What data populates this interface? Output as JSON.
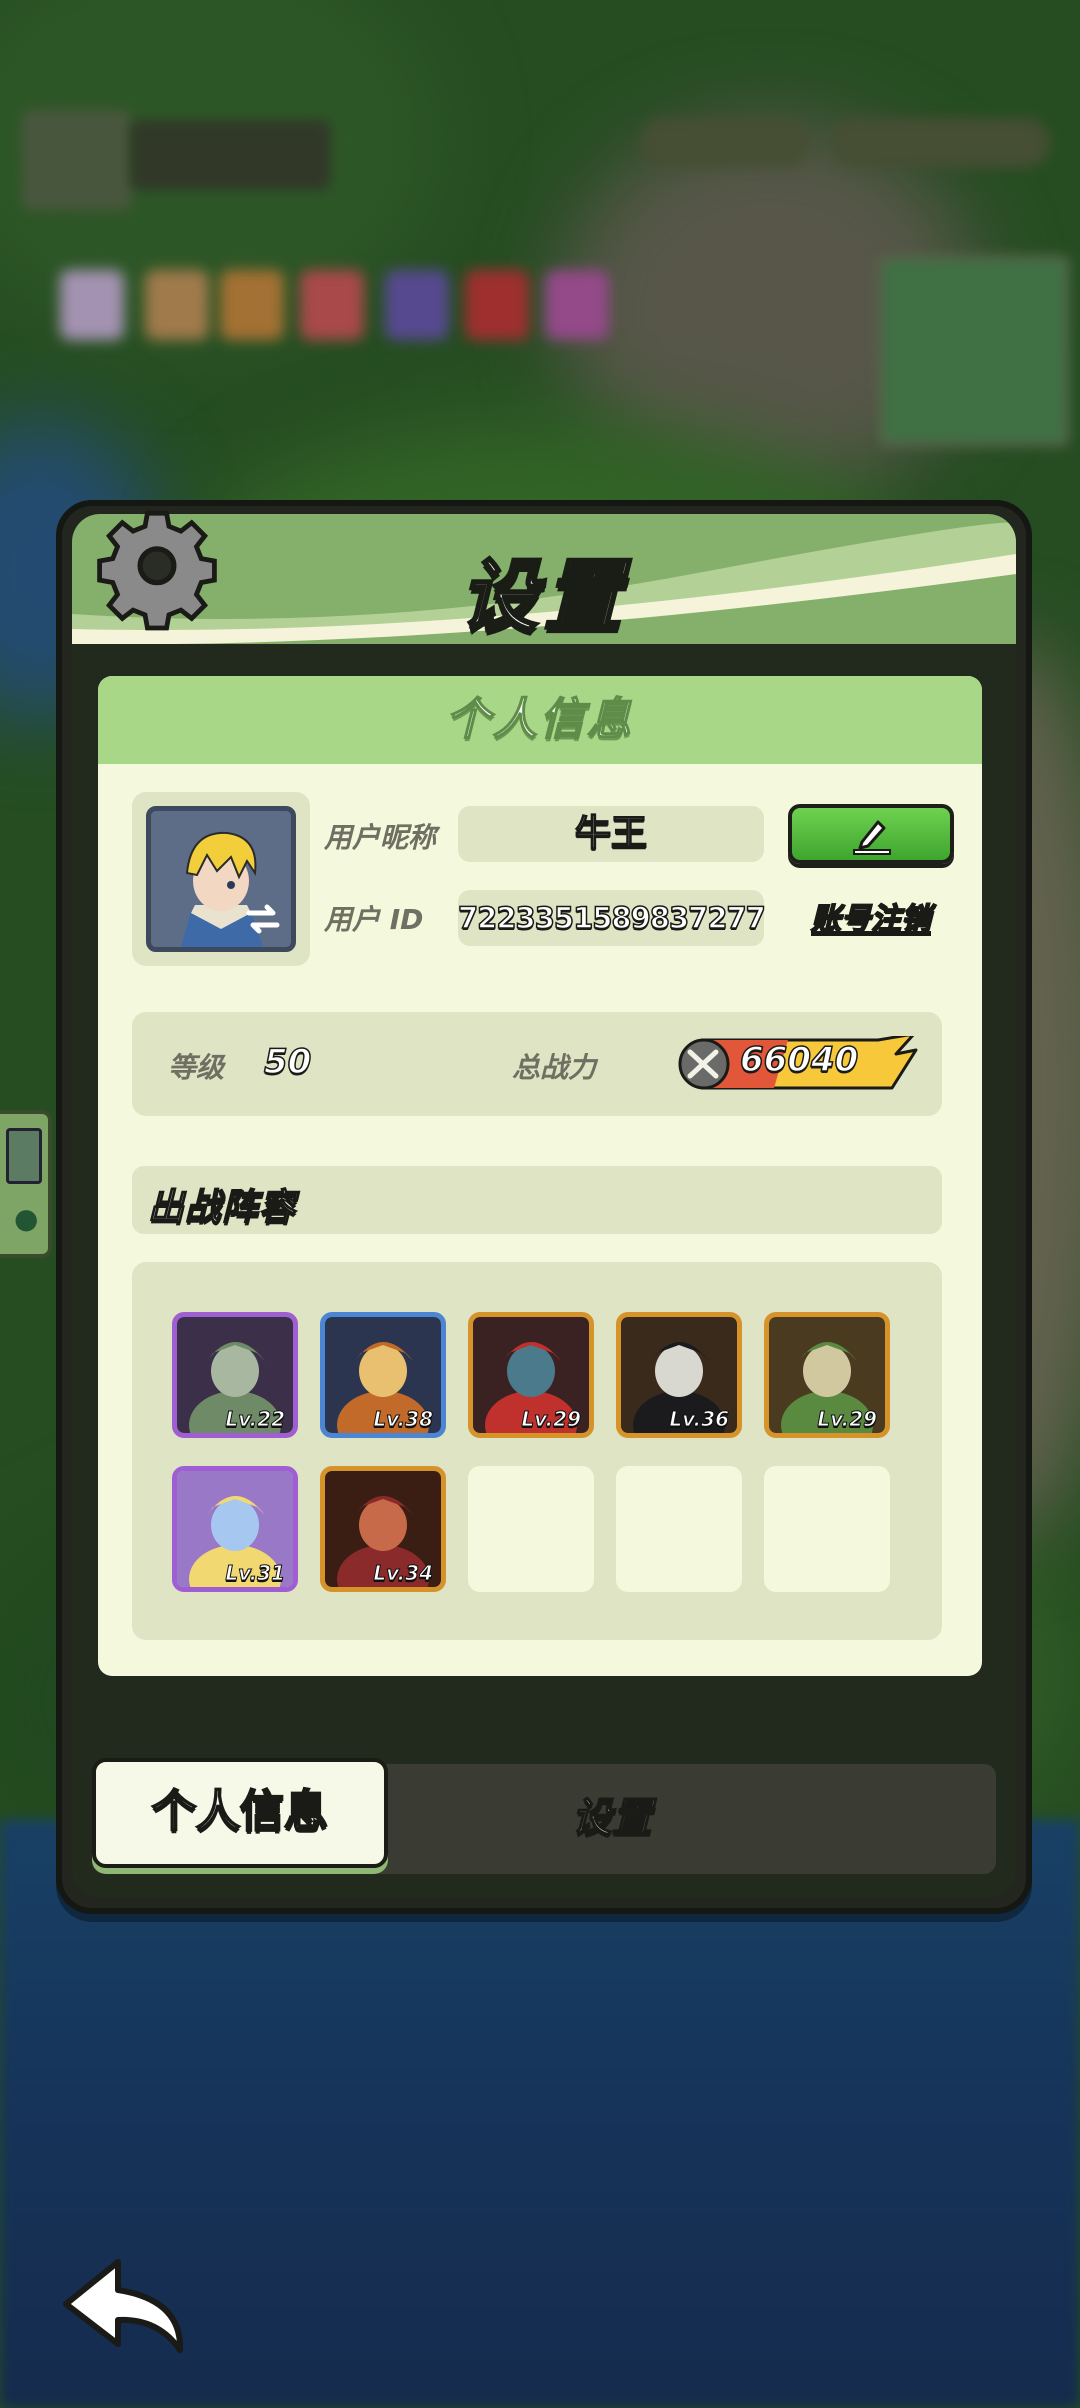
{
  "panel": {
    "title": "设置"
  },
  "info_card": {
    "header": "个人信息",
    "nickname_label": "用户昵称",
    "nickname_value": "牛王",
    "userid_label": "用户 ID",
    "userid_value": "7223351589837277",
    "cancel_account_label": "账号注销",
    "level_label": "等级",
    "level_value": "50",
    "power_label": "总战力",
    "power_value": "66040",
    "lineup_title": "出战阵容"
  },
  "lineup": [
    {
      "level": "Lv.22",
      "rarity": "purple",
      "palette": [
        "#3b2f4a",
        "#6e8a66",
        "#a8b7a0"
      ]
    },
    {
      "level": "Lv.38",
      "rarity": "blue",
      "palette": [
        "#2c3550",
        "#c26a2a",
        "#e8c070"
      ]
    },
    {
      "level": "Lv.29",
      "rarity": "orange",
      "palette": [
        "#3a2222",
        "#c0302c",
        "#4a7a8c"
      ]
    },
    {
      "level": "Lv.36",
      "rarity": "orange",
      "palette": [
        "#3a2a1c",
        "#1b1b1e",
        "#d8d8d0"
      ]
    },
    {
      "level": "Lv.29",
      "rarity": "orange",
      "palette": [
        "#4a3a20",
        "#5a8a40",
        "#d2c8a0"
      ]
    },
    {
      "level": "Lv.31",
      "rarity": "purple",
      "palette": [
        "#9a78c8",
        "#f2d870",
        "#a6c8f0"
      ]
    },
    {
      "level": "Lv.34",
      "rarity": "orange",
      "palette": [
        "#3a1e14",
        "#8a2a2a",
        "#c66a4a"
      ]
    },
    {
      "level": "",
      "rarity": "empty"
    },
    {
      "level": "",
      "rarity": "empty"
    },
    {
      "level": "",
      "rarity": "empty"
    }
  ],
  "tabs": {
    "active": "个人信息",
    "inactive": "设置"
  },
  "colors": {
    "header_green": "#84b06b",
    "card_bg": "#f4f9de",
    "button_green": "#4fb83a"
  }
}
